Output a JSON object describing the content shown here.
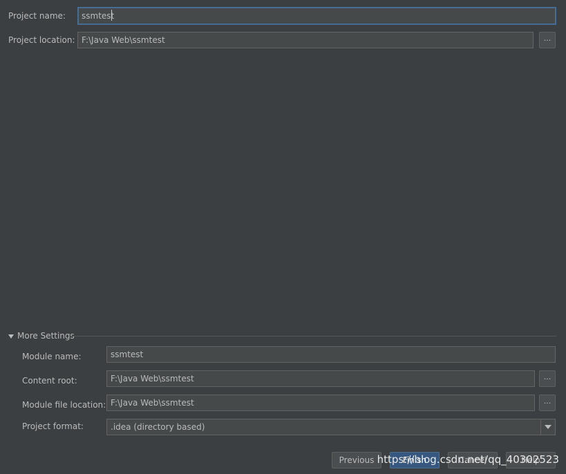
{
  "project": {
    "name_label": "Project name:",
    "name_value": "ssmtest",
    "location_label": "Project location:",
    "location_value": "F:\\Java Web\\ssmtest",
    "browse_label": "..."
  },
  "more_settings": {
    "title": "More Settings",
    "module_name_label": "Module name:",
    "module_name_value": "ssmtest",
    "content_root_label": "Content root:",
    "content_root_value": "F:\\Java Web\\ssmtest",
    "module_file_location_label": "Module file location:",
    "module_file_location_value": "F:\\Java Web\\ssmtest",
    "project_format_label": "Project format:",
    "project_format_value": ".idea (directory based)",
    "browse_label": "..."
  },
  "buttons": {
    "previous": "Previous",
    "finish": "Finish",
    "cancel": "Cancel",
    "help": "Help"
  },
  "watermark": "https://blog.csdn.net/qq_40302523",
  "colors": {
    "background": "#3c3f41",
    "field_background": "#45494a",
    "focus_border": "#466d94",
    "primary_button": "#365880",
    "text": "#bbbbbb"
  },
  "icons": {
    "section_toggle": "triangle-down-icon",
    "dropdown": "chevron-down-icon"
  }
}
